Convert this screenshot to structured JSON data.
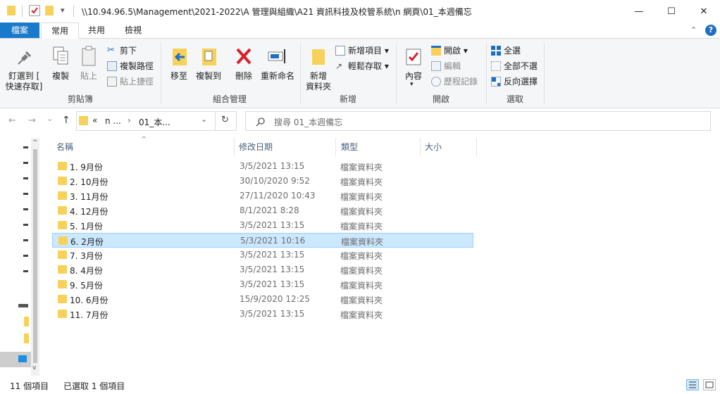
{
  "title_bar": {
    "path": "\\\\10.94.96.5\\Management\\2021-2022\\A 管理與組織\\A21 資訊科技及校管系統\\n 網頁\\01_本週備忘",
    "min_glyph": "—",
    "max_glyph": "☐",
    "close_glyph": "✕"
  },
  "ribbon_tabs": [
    "檔案",
    "常用",
    "共用",
    "檢視"
  ],
  "ribbon": {
    "clipboard": {
      "pin_label_1": "釘選到 [",
      "pin_label_2": "快速存取]",
      "copy": "複製",
      "paste": "貼上",
      "cut": "剪下",
      "copy_path": "複製路徑",
      "paste_shortcut": "貼上捷徑",
      "group": "剪貼簿"
    },
    "organize": {
      "move_to": "移至",
      "copy_to": "複製到",
      "delete": "刪除",
      "rename": "重新命名",
      "group": "組合管理"
    },
    "new": {
      "new_folder_1": "新增",
      "new_folder_2": "資料夾",
      "new_item": "新增項目 ▾",
      "easy_access": "輕鬆存取 ▾",
      "group": "新增"
    },
    "open": {
      "properties": "內容",
      "open": "開啟 ▾",
      "edit": "編輯",
      "history": "歷程記錄",
      "group": "開啟"
    },
    "select": {
      "select_all": "全選",
      "select_none": "全部不選",
      "invert": "反向選擇",
      "group": "選取"
    }
  },
  "nav": {
    "back": "←",
    "forward": "→",
    "recent": "⌄",
    "up": "↑",
    "address_overflow": "«",
    "crumb_1": "n ...",
    "crumb_sep": "›",
    "crumb_2": "01_本...",
    "dropdown": "⌄",
    "refresh": "↻",
    "search_placeholder": "搜尋 01_本週備忘"
  },
  "columns": {
    "name": "名稱",
    "date": "修改日期",
    "type": "類型",
    "size": "大小",
    "sort_glyph": "^"
  },
  "rows": [
    {
      "name": "1. 9月份",
      "date": "3/5/2021 13:15",
      "type": "檔案資料夾"
    },
    {
      "name": "2. 10月份",
      "date": "30/10/2020 9:52",
      "type": "檔案資料夾"
    },
    {
      "name": "3. 11月份",
      "date": "27/11/2020 10:43",
      "type": "檔案資料夾"
    },
    {
      "name": "4. 12月份",
      "date": "8/1/2021 8:28",
      "type": "檔案資料夾"
    },
    {
      "name": "5. 1月份",
      "date": "3/5/2021 13:15",
      "type": "檔案資料夾"
    },
    {
      "name": "6. 2月份",
      "date": "5/3/2021 10:16",
      "type": "檔案資料夾"
    },
    {
      "name": "7. 3月份",
      "date": "3/5/2021 13:15",
      "type": "檔案資料夾"
    },
    {
      "name": "8. 4月份",
      "date": "3/5/2021 13:15",
      "type": "檔案資料夾"
    },
    {
      "name": "9. 5月份",
      "date": "3/5/2021 13:15",
      "type": "檔案資料夾"
    },
    {
      "name": "10. 6月份",
      "date": "15/9/2020 12:25",
      "type": "檔案資料夾"
    },
    {
      "name": "11. 7月份",
      "date": "3/5/2021 13:15",
      "type": "檔案資料夾"
    }
  ],
  "selected_row": 5,
  "status": {
    "count": "11 個項目",
    "selected": "已選取 1 個項目"
  },
  "colors": {
    "accent": "#1979ca",
    "folder": "#f7d15a",
    "selection": "#cce8ff",
    "help": "#1d6fc4",
    "delete_red": "#d6202a"
  }
}
